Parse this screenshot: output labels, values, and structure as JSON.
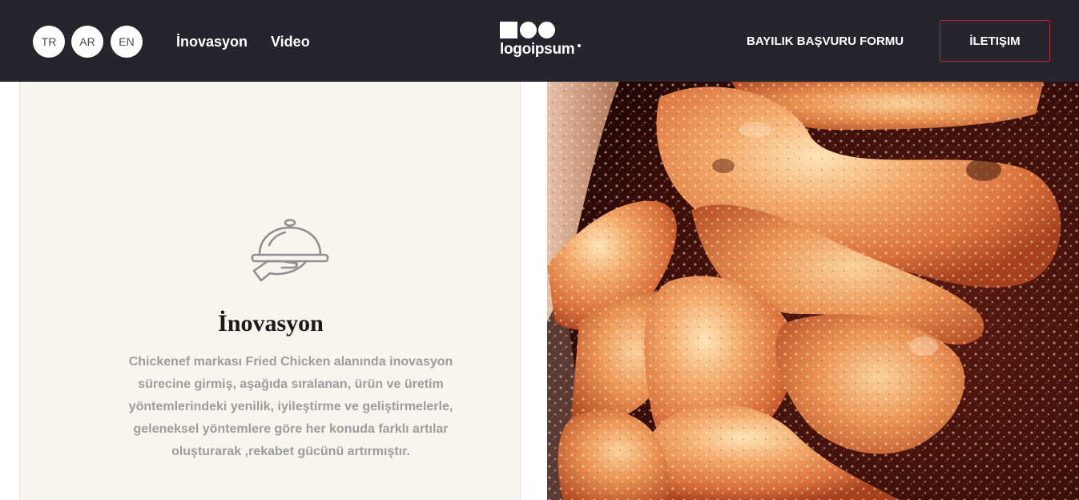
{
  "header": {
    "languages": [
      "TR",
      "AR",
      "EN"
    ],
    "nav": [
      "İnovasyon",
      "Video"
    ],
    "logo_text": "logoipsum",
    "cta_link": "BAYILIK BAŞVURU FORMU",
    "contact_button": "İLETIŞIM"
  },
  "panel": {
    "icon": "cloche-serving-tray-icon",
    "title": "İnovasyon",
    "text": "Chickenef markası Fried Chicken alanında inovasyon sürecine girmiş, aşağıda sıralanan, ürün ve üretim yöntemlerindeki yenilik, iyileştirme ve geliştirmelerle, geleneksel yöntemlere göre her konuda farklı artılar oluşturarak ,rekabet gücünü artırmıştır."
  },
  "photo": {
    "subject": "fried-chicken-drumsticks"
  },
  "colors": {
    "header_bg": "#26242d",
    "panel_bg": "#f8f4ee",
    "accent_border": "#b3263a",
    "body_text": "#9d9d9d"
  }
}
